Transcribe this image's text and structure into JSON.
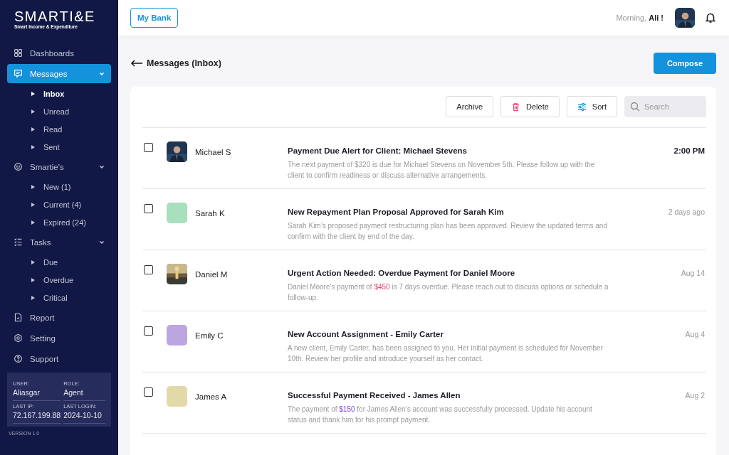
{
  "sidebar": {
    "logo": {
      "title": "SMARTI&E",
      "subtitle": "Smart Income & Expenditure"
    },
    "items": [
      {
        "label": "Dashboards",
        "selected": false
      },
      {
        "label": "Messages",
        "selected": true,
        "expanded": true,
        "children": [
          {
            "label": "Inbox",
            "selected": true
          },
          {
            "label": "Unread",
            "selected": false
          },
          {
            "label": "Read",
            "selected": false
          },
          {
            "label": "Sent",
            "selected": false
          }
        ]
      },
      {
        "label": "Smartie’s",
        "selected": false,
        "expanded": true,
        "children": [
          {
            "label": "New (1)",
            "selected": false
          },
          {
            "label": "Current (4)",
            "selected": false
          },
          {
            "label": "Expired (24)",
            "selected": false
          }
        ]
      },
      {
        "label": "Tasks",
        "selected": false,
        "expanded": true,
        "children": [
          {
            "label": "Due",
            "selected": false
          },
          {
            "label": "Overdue",
            "selected": false
          },
          {
            "label": "Critical",
            "selected": false
          }
        ]
      },
      {
        "label": "Report",
        "selected": false
      },
      {
        "label": "Setting",
        "selected": false
      },
      {
        "label": "Support",
        "selected": false
      }
    ],
    "info": [
      {
        "label": "USER:",
        "value": "Aliasgar"
      },
      {
        "label": "ROLE:",
        "value": "Agent"
      },
      {
        "label": "LAST IP:",
        "value": "72.167.199.88"
      },
      {
        "label": "LAST LOGIN:",
        "value": "2024-10-10"
      }
    ],
    "version": "VERSION 1.0"
  },
  "topbar": {
    "bank_button": "My Bank",
    "greeting": "Morning,",
    "user": "Ali !"
  },
  "page": {
    "title": "Messages (Inbox)",
    "compose": "Compose"
  },
  "toolbar": {
    "archive": "Archive",
    "delete": "Delete",
    "sort": "Sort",
    "search": {
      "placeholder": "Search"
    }
  },
  "messages": [
    {
      "checked": false,
      "avatar": {
        "kind": "picture"
      },
      "sender": "Michael S",
      "subject": "Payment Due Alert for Client: Michael Stevens",
      "preview": [
        {
          "text": "The next payment of $320 is due for Michael Stevens on November 5th. Please follow up with the client to confirm readiness or discuss alternative arrangements."
        }
      ],
      "time": "2:00 PM",
      "unread": true
    },
    {
      "checked": false,
      "avatar": {
        "kind": "swatch",
        "color": "#a8dfbd"
      },
      "sender": "Sarah K",
      "subject": "New Repayment Plan Proposal Approved for Sarah Kim",
      "preview": [
        {
          "text": "Sarah Kim’s proposed payment restructuring plan has been approved. Review the updated terms and confirm with the client by end of the day."
        }
      ],
      "time": "2 days ago",
      "unread": false
    },
    {
      "checked": false,
      "avatar": {
        "kind": "picture"
      },
      "sender": "Daniel M",
      "subject": "Urgent Action Needed: Overdue Payment for Daniel Moore",
      "preview": [
        {
          "text": "Daniel Moore's payment of "
        },
        {
          "text": "$450",
          "color": "#ef3e6d"
        },
        {
          "text": " is 7 days overdue. Please reach out to discuss options or schedule a follow-up."
        }
      ],
      "time": "Aug 14",
      "unread": false
    },
    {
      "checked": false,
      "avatar": {
        "kind": "swatch",
        "color": "#bca6e0"
      },
      "sender": "Emily C",
      "subject": "New Account Assignment - Emily Carter",
      "preview": [
        {
          "text": "A new client, Emily Carter, has been assigned to you. Her initial payment is scheduled for November 10th. Review her profile and introduce yourself as her contact."
        }
      ],
      "time": "Aug 4",
      "unread": false
    },
    {
      "checked": false,
      "avatar": {
        "kind": "swatch",
        "color": "#e2d9a8"
      },
      "sender": "James A",
      "subject": "Successful Payment Received - James Allen",
      "preview": [
        {
          "text": "The payment of "
        },
        {
          "text": "$150",
          "color": "#7b3fe4"
        },
        {
          "text": " for James Allen’s account was successfully processed. Update his account status and thank him for his prompt payment."
        }
      ],
      "time": "Aug 2",
      "unread": false
    }
  ]
}
